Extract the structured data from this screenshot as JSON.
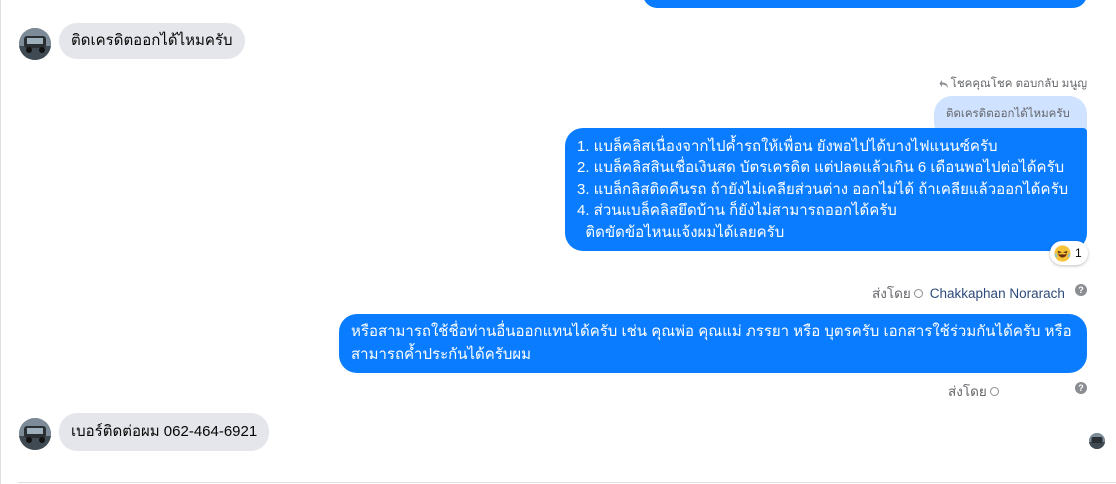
{
  "conversation": {
    "incoming_1": {
      "text": "ติดเครดิตออกได้ไหมครับ"
    },
    "reply_header": "โชคคุณโชค ตอบกลับ มนูญ",
    "reply_quote": "ติดเครดิตออกได้ไหมครับ",
    "outgoing_1": {
      "lines": [
        "1. แบล็คลิสเนื่องจากไปค้ำรถให้เพื่อน ยังพอไปได้บางไฟแนนซ์ครับ",
        "2. แบล็คลิสสินเชื่อเงินสด บัตรเครดิต แต่ปลดแล้วเกิน 6 เดือนพอไปต่อได้ครับ",
        "3. แบล็กลิสติดคืนรถ ถ้ายังไม่เคลียส่วนต่าง ออกไม่ได้ ถ้าเคลียแล้วออกได้ครับ",
        "4. ส่วนแบล็คลิสยึดบ้าน ก็ยังไม่สามารถออกได้ครับ",
        "  ติดขัดข้อไหนแจ้งผมได้เลยครับ"
      ],
      "reaction_count": "1"
    },
    "sent_by_1": {
      "label": "ส่งโดย",
      "agent": "Chakkaphan Norarach",
      "help": "?"
    },
    "outgoing_2": {
      "lines": [
        "หรือสามารถใช้ชื่อท่านอื่นออกแทนได้ครับ เช่น คุณพ่อ คุณแม่ ภรรยา หรือ บุตรครับ เอกสารใช้ร่วมกันได้ครับ หรือ",
        "สามารถค้ำประกันได้ครับผม"
      ]
    },
    "sent_by_2": {
      "label": "ส่งโดย",
      "help": "?"
    },
    "incoming_2": {
      "text": "เบอร์ติดต่อผม 062-464-6921"
    }
  },
  "colors": {
    "outgoing_bubble": "#0a7cff",
    "incoming_bubble": "#e4e6eb",
    "quote_bubble": "#cfe2ff",
    "meta_text": "#65676b"
  },
  "icons": {
    "reply": "reply-arrow-icon",
    "reaction": "laughing-emoji-icon",
    "sent_status": "check-circle-icon",
    "help": "question-mark-icon"
  }
}
